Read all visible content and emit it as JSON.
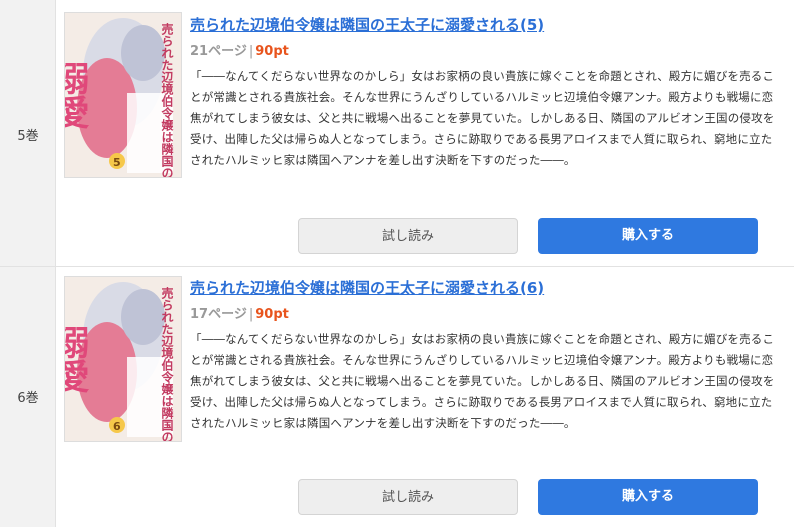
{
  "items": [
    {
      "volume": "5巻",
      "title": "売られた辺境伯令嬢は隣国の王太子に溺愛される(5)",
      "pages": "21ページ",
      "separator": "|",
      "price": "90pt",
      "description": "「――なんてくだらない世界なのかしら」女はお家柄の良い貴族に嫁ぐことを命題とされ、殿方に媚びを売ることが常識とされる貴族社会。そんな世界にうんざりしているハルミッヒ辺境伯令嬢アンナ。殿方よりも戦場に恋焦がれてしまう彼女は、父と共に戦場へ出ることを夢見ていた。しかしある日、隣国のアルビオン王国の侵攻を受け、出陣した父は帰らぬ人となってしまう。さらに跡取りである長男アロイスまで人質に取られ、窮地に立たされたハルミッヒ家は隣国へアンナを差し出す決断を下すのだった――。",
      "trial_label": "試し読み",
      "buy_label": "購入する",
      "cover": {
        "title_text": "売られた辺境伯令嬢は隣国の王太子に",
        "big_text": "溺愛",
        "volume_number": "5"
      }
    },
    {
      "volume": "6巻",
      "title": "売られた辺境伯令嬢は隣国の王太子に溺愛される(6)",
      "pages": "17ページ",
      "separator": "|",
      "price": "90pt",
      "description": "「――なんてくだらない世界なのかしら」女はお家柄の良い貴族に嫁ぐことを命題とされ、殿方に媚びを売ることが常識とされる貴族社会。そんな世界にうんざりしているハルミッヒ辺境伯令嬢アンナ。殿方よりも戦場に恋焦がれてしまう彼女は、父と共に戦場へ出ることを夢見ていた。しかしある日、隣国のアルビオン王国の侵攻を受け、出陣した父は帰らぬ人となってしまう。さらに跡取りである長男アロイスまで人質に取られ、窮地に立たされたハルミッヒ家は隣国へアンナを差し出す決断を下すのだった――。",
      "trial_label": "試し読み",
      "buy_label": "購入する",
      "cover": {
        "title_text": "売られた辺境伯令嬢は隣国の王太子に",
        "big_text": "溺愛",
        "volume_number": "6"
      }
    }
  ],
  "colors": {
    "link": "#2b6fd6",
    "price": "#e8541d",
    "buy_button": "#2f79e0",
    "trial_button": "#eeeeee"
  }
}
